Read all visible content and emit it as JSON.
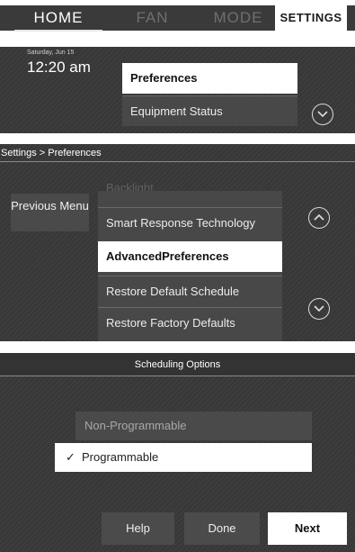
{
  "nav": {
    "tabs": [
      {
        "label": "HOME"
      },
      {
        "label": "FAN"
      },
      {
        "label": "MODE"
      },
      {
        "label": "SETTINGS"
      }
    ],
    "active_tab": "SETTINGS"
  },
  "screen1": {
    "date": "Saturday, Jun 15",
    "time": "12:20 am",
    "menu": [
      {
        "label": "Preferences",
        "selected": true
      },
      {
        "label": "Equipment Status",
        "selected": false
      }
    ],
    "scroll_down_icon": "chevron-down-icon"
  },
  "screen2": {
    "breadcrumb": "Settings > Preferences",
    "previous_menu_label": "Previous Menu",
    "scrolled_item": "Backlight",
    "menu": [
      {
        "label": "Smart Response Technology",
        "selected": false
      },
      {
        "label": "AdvancedPreferences",
        "selected": true
      },
      {
        "label": "Restore Default Schedule",
        "selected": false
      },
      {
        "label": "Restore Factory Defaults",
        "selected": false
      }
    ],
    "scroll_up_icon": "chevron-up-icon",
    "scroll_down_icon": "chevron-down-icon"
  },
  "screen3": {
    "title": "Scheduling Options",
    "options": [
      {
        "label": "Non-Programmable",
        "checked": false
      },
      {
        "label": "Programmable",
        "checked": true
      }
    ],
    "check_mark": "✓",
    "buttons": {
      "help": "Help",
      "done": "Done",
      "next": "Next"
    }
  },
  "colors": {
    "background_dark": "#383838",
    "item_gray": "#484848",
    "selected_white": "#ffffff"
  }
}
